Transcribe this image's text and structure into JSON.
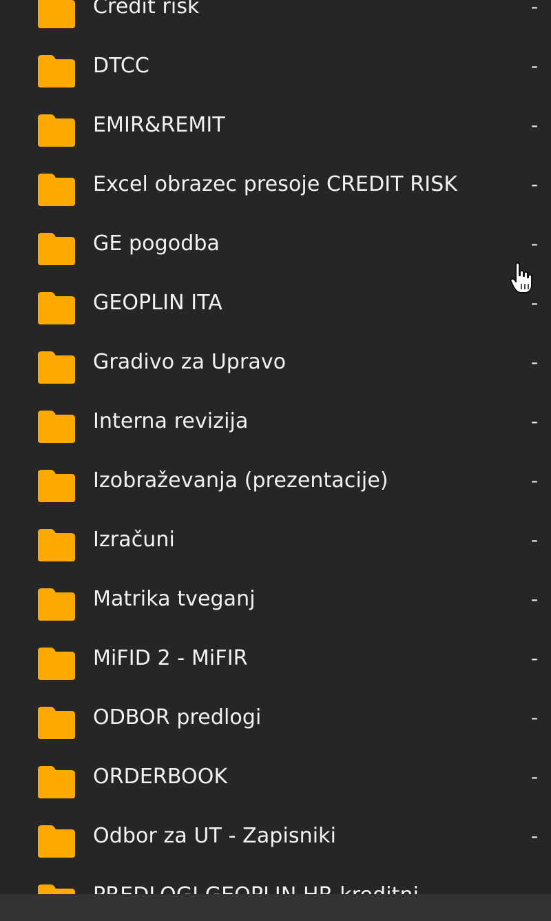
{
  "folders": [
    {
      "name": "Credit risk",
      "size": "-"
    },
    {
      "name": "DTCC",
      "size": "-"
    },
    {
      "name": "EMIR&REMIT",
      "size": "-"
    },
    {
      "name": "Excel obrazec presoje CREDIT RISK",
      "size": "-"
    },
    {
      "name": "GE pogodba",
      "size": "-"
    },
    {
      "name": "GEOPLIN ITA",
      "size": "-"
    },
    {
      "name": "Gradivo za Upravo",
      "size": "-"
    },
    {
      "name": "Interna revizija",
      "size": "-"
    },
    {
      "name": "Izobraževanja (prezentacije)",
      "size": "-"
    },
    {
      "name": "Izračuni",
      "size": "-"
    },
    {
      "name": "Matrika tveganj",
      "size": "-"
    },
    {
      "name": "MiFID 2 - MiFIR",
      "size": "-"
    },
    {
      "name": "ODBOR predlogi",
      "size": "-"
    },
    {
      "name": "ORDERBOOK",
      "size": "-"
    },
    {
      "name": "Odbor za UT - Zapisniki",
      "size": "-"
    },
    {
      "name": "PREDLOGI GEOPLIN HR  kreditni",
      "size": ""
    }
  ],
  "colors": {
    "background": "#262626",
    "folder": "#FFAA00",
    "text": "#F2F2F2",
    "bottom_bar": "#333333"
  },
  "icons": {
    "folder": "folder-icon",
    "cursor": "hand-pointer-icon"
  }
}
